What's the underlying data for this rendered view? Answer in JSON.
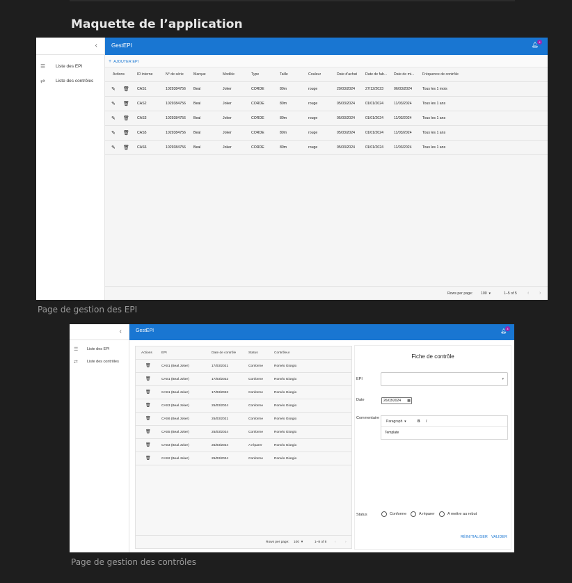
{
  "document": {
    "heading": "Maquette de l’application",
    "caption_epi": "Page de gestion des EPI",
    "caption_controles": "Page de gestion des contrôles"
  },
  "icons": {
    "collapse": "chevron-left-icon",
    "bell": "bell-icon",
    "list": "list-icon",
    "controls": "swap-icon",
    "edit": "pencil-icon",
    "delete": "trash-icon",
    "add": "plus-icon"
  },
  "colors": {
    "appbar": "#1976d2",
    "badge": "#9c27b0",
    "background": "#1e1e1e"
  },
  "app_epi": {
    "title": "GestEPI",
    "badge": "4",
    "sidebar": [
      "Liste des EPI",
      "Liste des contrôles"
    ],
    "add_button": "AJOUTER EPI",
    "columns": [
      "Actions",
      "ID interne",
      "N° de série",
      "Marque",
      "Modèle",
      "Type",
      "Taille",
      "Couleur",
      "Date d'achat",
      "Date de fab...",
      "Date de mi...",
      "Fréquence de contrôle"
    ],
    "rows": [
      [
        "CAS1",
        "1029384756",
        "Beal",
        "Joker",
        "CORDE",
        "80m",
        "rouge",
        "29/03/2024",
        "27/12/2023",
        "06/03/2024",
        "Tous les 1 mois"
      ],
      [
        "CAS2",
        "1029384756",
        "Beal",
        "Joker",
        "CORDE",
        "80m",
        "rouge",
        "05/03/2024",
        "01/01/2024",
        "11/03/2024",
        "Tous les 1 ans"
      ],
      [
        "CAS3",
        "1029384756",
        "Beal",
        "Joker",
        "CORDE",
        "80m",
        "rouge",
        "05/03/2024",
        "01/01/2024",
        "11/03/2024",
        "Tous les 1 ans"
      ],
      [
        "CAS5",
        "1029384756",
        "Beal",
        "Joker",
        "CORDE",
        "80m",
        "rouge",
        "05/03/2024",
        "01/01/2024",
        "11/03/2024",
        "Tous les 1 ans"
      ],
      [
        "CAS6",
        "1029384756",
        "Beal",
        "Joker",
        "CORDE",
        "80m",
        "rouge",
        "05/03/2024",
        "01/01/2024",
        "11/03/2024",
        "Tous les 1 ans"
      ]
    ],
    "footer": {
      "rows_per_page_label": "Rows per page:",
      "rows_per_page": "100",
      "range": "1–5 of 5"
    }
  },
  "app_controles": {
    "title": "GestEPI",
    "badge": "4",
    "sidebar": [
      "Liste des EPI",
      "Liste des contrôles"
    ],
    "columns": [
      "Actions",
      "EPI",
      "Date de contrôle",
      "Status",
      "Contrôleur"
    ],
    "rows": [
      [
        "CAS1 (Beal Joker)",
        "17/03/2021",
        "Conforme",
        "Roméo Giorgio"
      ],
      [
        "CAS1 (Beal Joker)",
        "17/03/2022",
        "Conforme",
        "Roméo Giorgio"
      ],
      [
        "CAS1 (Beal Joker)",
        "17/03/2023",
        "Conforme",
        "Roméo Giorgio"
      ],
      [
        "CAS3 (Beal Joker)",
        "25/03/2024",
        "Conforme",
        "Roméo Giorgio"
      ],
      [
        "CAS6 (Beal Joker)",
        "25/03/2021",
        "Conforme",
        "Roméo Giorgio"
      ],
      [
        "CAS5 (Beal Joker)",
        "25/03/2024",
        "Conforme",
        "Roméo Giorgio"
      ],
      [
        "CAS3 (Beal Joker)",
        "25/03/2024",
        "A réparer",
        "Roméo Giorgio"
      ],
      [
        "CAS2 (Beal Joker)",
        "25/03/2024",
        "Conforme",
        "Roméo Giorgio"
      ]
    ],
    "footer": {
      "rows_per_page_label": "Rows per page:",
      "rows_per_page": "100",
      "range": "1–8 of 8"
    },
    "form": {
      "title": "Fiche de contrôle",
      "epi_label": "EPI",
      "epi_value": "",
      "date_label": "Date",
      "date_value": "26/03/2024",
      "comment_label": "Commentaire",
      "editor_format": "Paragraph",
      "editor_bold": "B",
      "editor_italic": "I",
      "editor_content": "Template",
      "status_label": "Status",
      "status_options": [
        "Conforme",
        "A réparer",
        "A mettre au rebut"
      ],
      "reset_button": "RÉINITIALISER",
      "submit_button": "VALIDER"
    }
  }
}
